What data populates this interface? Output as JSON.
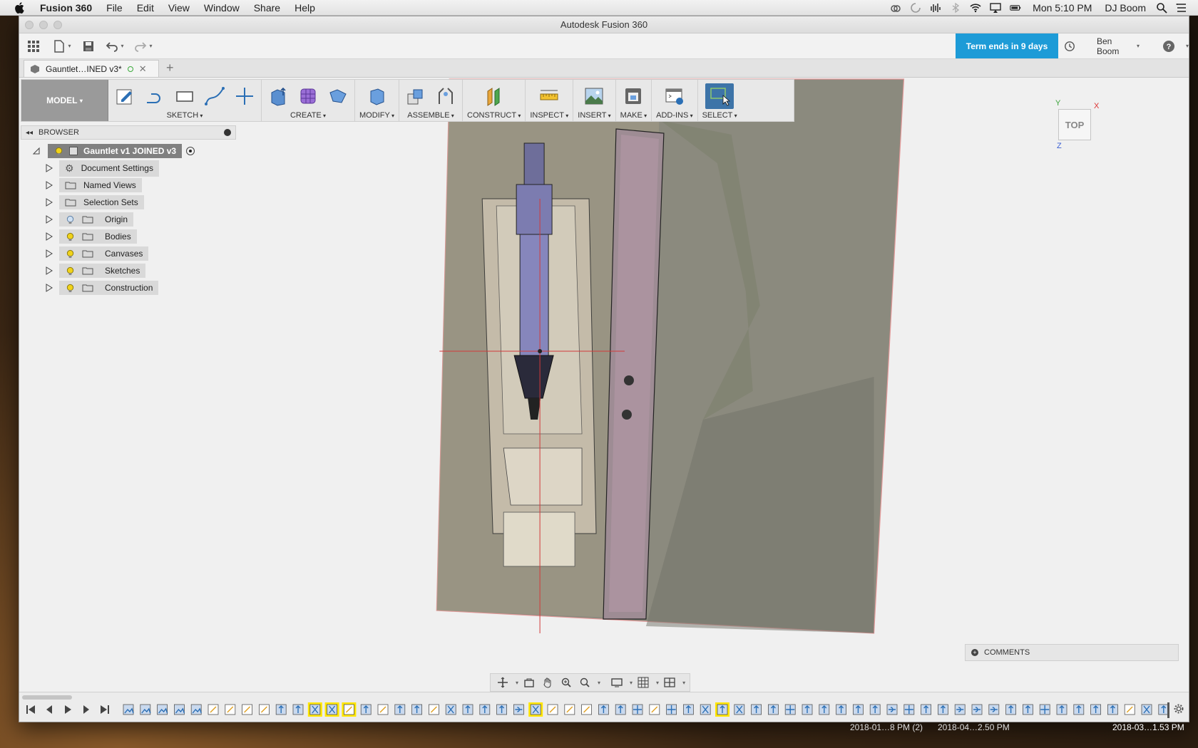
{
  "menubar": {
    "app_name": "Fusion 360",
    "menus": [
      "File",
      "Edit",
      "View",
      "Window",
      "Share",
      "Help"
    ],
    "clock": "Mon 5:10 PM",
    "user": "DJ Boom"
  },
  "window": {
    "title": "Autodesk Fusion 360",
    "term_button": "Term ends in 9 days",
    "account_name": "Ben Boom",
    "doc_tab": "Gauntlet…INED v3*"
  },
  "toolbar": {
    "workspace": "MODEL",
    "groups": [
      "SKETCH",
      "CREATE",
      "MODIFY",
      "ASSEMBLE",
      "CONSTRUCT",
      "INSPECT",
      "INSERT",
      "MAKE",
      "ADD-INS",
      "SELECT"
    ]
  },
  "browser": {
    "title": "BROWSER",
    "root": "Gauntlet v1 JOINED v3",
    "items": [
      {
        "label": "Document Settings",
        "icon": "gear-icon"
      },
      {
        "label": "Named Views",
        "icon": "folder-icon"
      },
      {
        "label": "Selection Sets",
        "icon": "folder-icon"
      },
      {
        "label": "Origin",
        "icon": "folder-icon",
        "bulb": "off"
      },
      {
        "label": "Bodies",
        "icon": "folder-icon",
        "bulb": "on"
      },
      {
        "label": "Canvases",
        "icon": "folder-icon",
        "bulb": "on"
      },
      {
        "label": "Sketches",
        "icon": "folder-icon",
        "bulb": "on"
      },
      {
        "label": "Construction",
        "icon": "folder-icon",
        "bulb": "on"
      }
    ]
  },
  "viewcube": {
    "face": "TOP",
    "axis_x": "X",
    "axis_y": "Y",
    "axis_z": "Z"
  },
  "comments": {
    "label": "COMMENTS"
  },
  "desktop_labels": {
    "label_a": "2018-01…8 PM (2)",
    "label_b": "2018-04…2.50 PM",
    "label_c": "2018-03…1.53 PM"
  },
  "colors": {
    "accent": "#1d9bd7",
    "workspace_btn": "#9a9a9a",
    "bulb_on": "#f0d21a",
    "timeline_highlight": "#ffe600"
  }
}
